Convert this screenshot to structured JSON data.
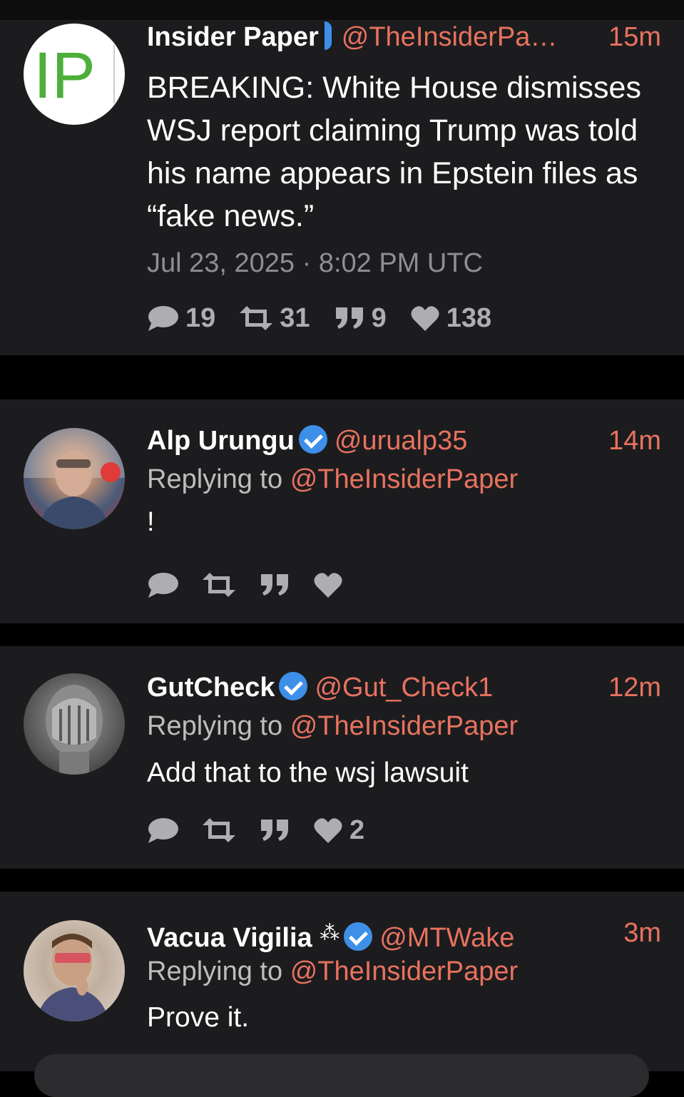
{
  "tweets": [
    {
      "name": "Insider Paper",
      "handle": "@TheInsiderPa…",
      "time": "15m",
      "avatar_text": "IP",
      "text": "BREAKING: White House dismisses WSJ report claiming Trump was told his name appears in Epstein files as “fake news.”",
      "timestamp": "Jul 23, 2025 · 8:02 PM UTC",
      "replies": "19",
      "retweets": "31",
      "quotes": "9",
      "likes": "138"
    },
    {
      "name": "Alp Urungu",
      "handle": "@urualp35",
      "time": "14m",
      "replying_label": "Replying to",
      "replying_to": "@TheInsiderPaper",
      "text": "!",
      "likes": ""
    },
    {
      "name": "GutCheck",
      "handle": "@Gut_Check1",
      "time": "12m",
      "replying_label": "Replying to",
      "replying_to": "@TheInsiderPaper",
      "text": "Add that to the wsj lawsuit",
      "likes": "2"
    },
    {
      "name": "Vacua Vigilia",
      "name_glyph": "⁂",
      "handle": "@MTWake",
      "time": "3m",
      "replying_label": "Replying to",
      "replying_to": "@TheInsiderPaper",
      "text": "Prove it."
    }
  ],
  "colors": {
    "background": "#000000",
    "card": "#1c1c1e",
    "accent": "#e8725f",
    "verified": "#3d8fe8",
    "muted": "#aeaeb2"
  }
}
